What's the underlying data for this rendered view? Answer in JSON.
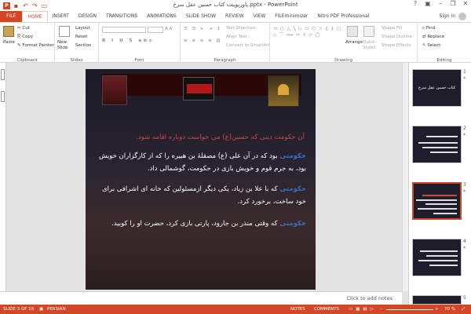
{
  "window": {
    "title": "پاورپوینت کتاب حسین عقل سرخ.pptx - PowerPoint"
  },
  "tabs": [
    {
      "label": "FILE"
    },
    {
      "label": "HOME"
    },
    {
      "label": "INSERT"
    },
    {
      "label": "DESIGN"
    },
    {
      "label": "TRANSITIONS"
    },
    {
      "label": "ANIMATIONS"
    },
    {
      "label": "SLIDE SHOW"
    },
    {
      "label": "REVIEW"
    },
    {
      "label": "VIEW"
    },
    {
      "label": "FILEminimizer"
    },
    {
      "label": "Nitro PDF Professional"
    }
  ],
  "signin": "Sign in",
  "ribbon": {
    "clipboard": {
      "label": "Clipboard",
      "paste": "Paste",
      "cut": "Cut",
      "copy": "Copy",
      "painter": "Format Painter"
    },
    "slides": {
      "label": "Slides",
      "new_slide": "New Slide",
      "layout": "Layout",
      "reset": "Reset",
      "section": "Section"
    },
    "font": {
      "label": "Font"
    },
    "paragraph": {
      "label": "Paragraph",
      "text_direction": "Text Direction",
      "align_text": "Align Text",
      "smartart": "Convert to SmartArt"
    },
    "drawing": {
      "label": "Drawing",
      "arrange": "Arrange",
      "quick_styles": "Quick Styles",
      "fill": "Shape Fill",
      "outline": "Shape Outline",
      "effects": "Shape Effects"
    },
    "editing": {
      "label": "Editing",
      "find": "Find",
      "replace": "Replace",
      "select": "Select"
    }
  },
  "slide": {
    "heading": "آن حکومت دینی که حسین(ع) می خواست دوباره اقامه شود.",
    "paragraphs": [
      {
        "lines": [
          {
            "hl": "حکومتی",
            "text": " بود که در آن علی (ع) مصقلۀ بن هبیره را که از کارگزاران خویش"
          },
          {
            "hl": "",
            "text": "بود، به جرم قوم و خویش بازی در حکومت، گوشمالی داد."
          }
        ]
      },
      {
        "lines": [
          {
            "hl": "حکومتی",
            "text": " که با علا بن زیاد، یکی دیگر ازمسئولین که خانه ای اشرافی برای"
          },
          {
            "hl": "",
            "text": "خود ساخت، برخورد کرد."
          }
        ]
      },
      {
        "lines": [
          {
            "hl": "حکومتی",
            "text": " که وقتی منذر بن جارود، پارتی بازی کرد، حضرت او را کوبید."
          }
        ]
      }
    ]
  },
  "notes": {
    "placeholder": "Click to add notes"
  },
  "thumbnails": [
    {
      "number": "1",
      "star": "*",
      "title": "کتاب حسین عقل سرخ"
    },
    {
      "number": "2",
      "star": "*",
      "title": ""
    },
    {
      "number": "3",
      "star": "*",
      "title": ""
    },
    {
      "number": "4",
      "star": "*",
      "title": ""
    },
    {
      "number": "5",
      "star": "",
      "title": ""
    }
  ],
  "status": {
    "slide": "SLIDE 3 OF 16",
    "language": "PERSIAN",
    "notes": "NOTES",
    "comments": "COMMENTS",
    "zoom": "70 %"
  },
  "colors": {
    "accent": "#d24726",
    "slide_bg": "#1d1c27",
    "heading": "#c94a41",
    "highlight": "#3a6cc2"
  }
}
